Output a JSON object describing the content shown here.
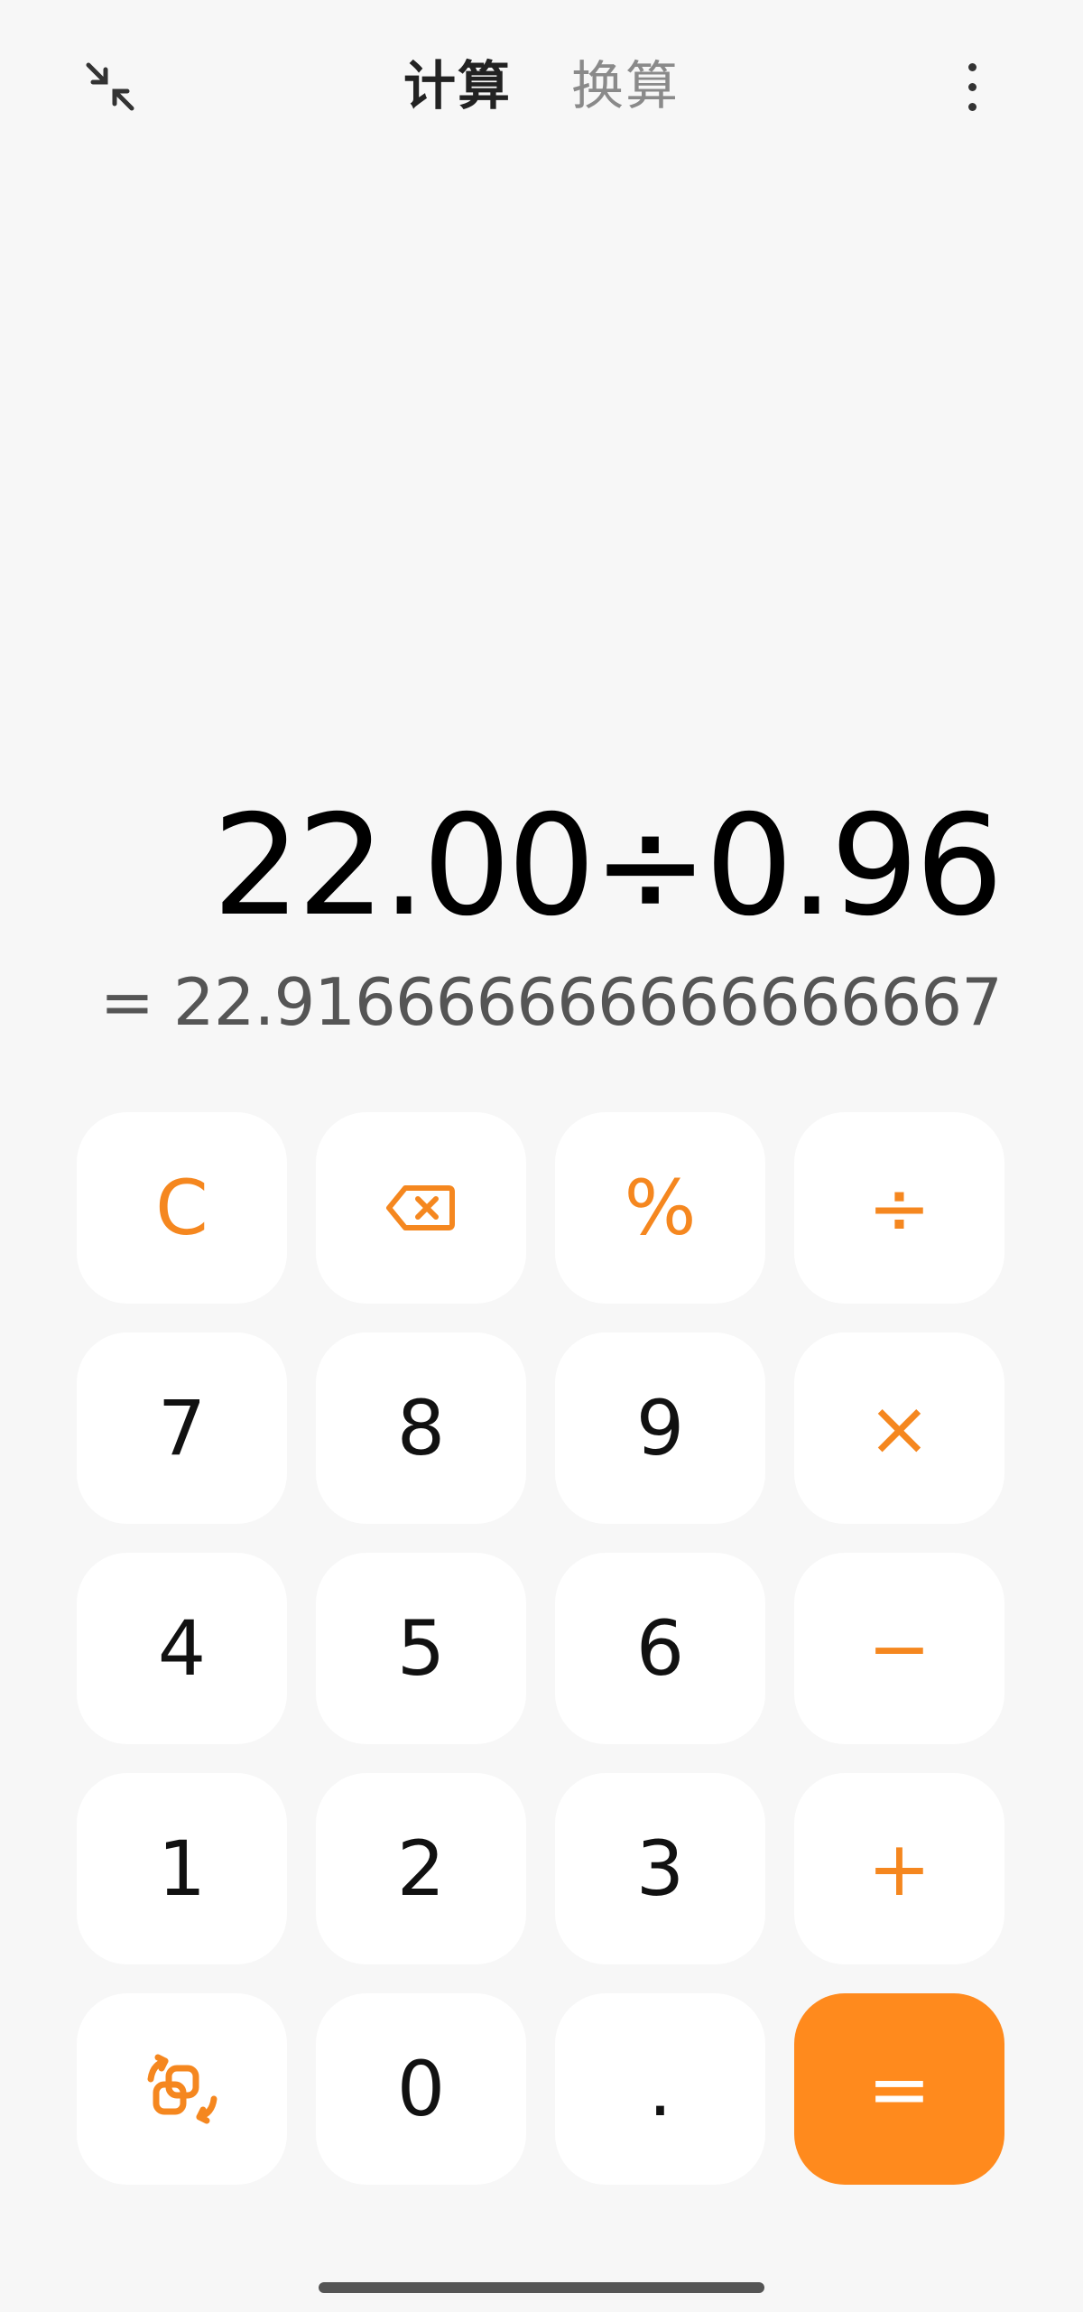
{
  "header": {
    "tabs": [
      {
        "label": "计算",
        "active": true
      },
      {
        "label": "换算",
        "active": false
      }
    ]
  },
  "display": {
    "expression": "22.00÷0.96",
    "result": "= 22.916666666666666667"
  },
  "keypad": {
    "rows": [
      [
        "C",
        "backspace-icon",
        "%",
        "÷"
      ],
      [
        "7",
        "8",
        "9",
        "×"
      ],
      [
        "4",
        "5",
        "6",
        "−"
      ],
      [
        "1",
        "2",
        "3",
        "+"
      ],
      [
        "switch-mode-icon",
        "0",
        ".",
        "="
      ]
    ],
    "labels": {
      "clear": "C",
      "percent": "%",
      "divide": "÷",
      "multiply": "×",
      "minus": "−",
      "plus": "+",
      "equals": "=",
      "seven": "7",
      "eight": "8",
      "nine": "9",
      "four": "4",
      "five": "5",
      "six": "6",
      "one": "1",
      "two": "2",
      "three": "3",
      "zero": "0",
      "dot": "."
    }
  },
  "colors": {
    "accent": "#f5871f",
    "equals_bg": "#ff8a1d",
    "background": "#f7f7f7",
    "key_bg": "#ffffff"
  }
}
